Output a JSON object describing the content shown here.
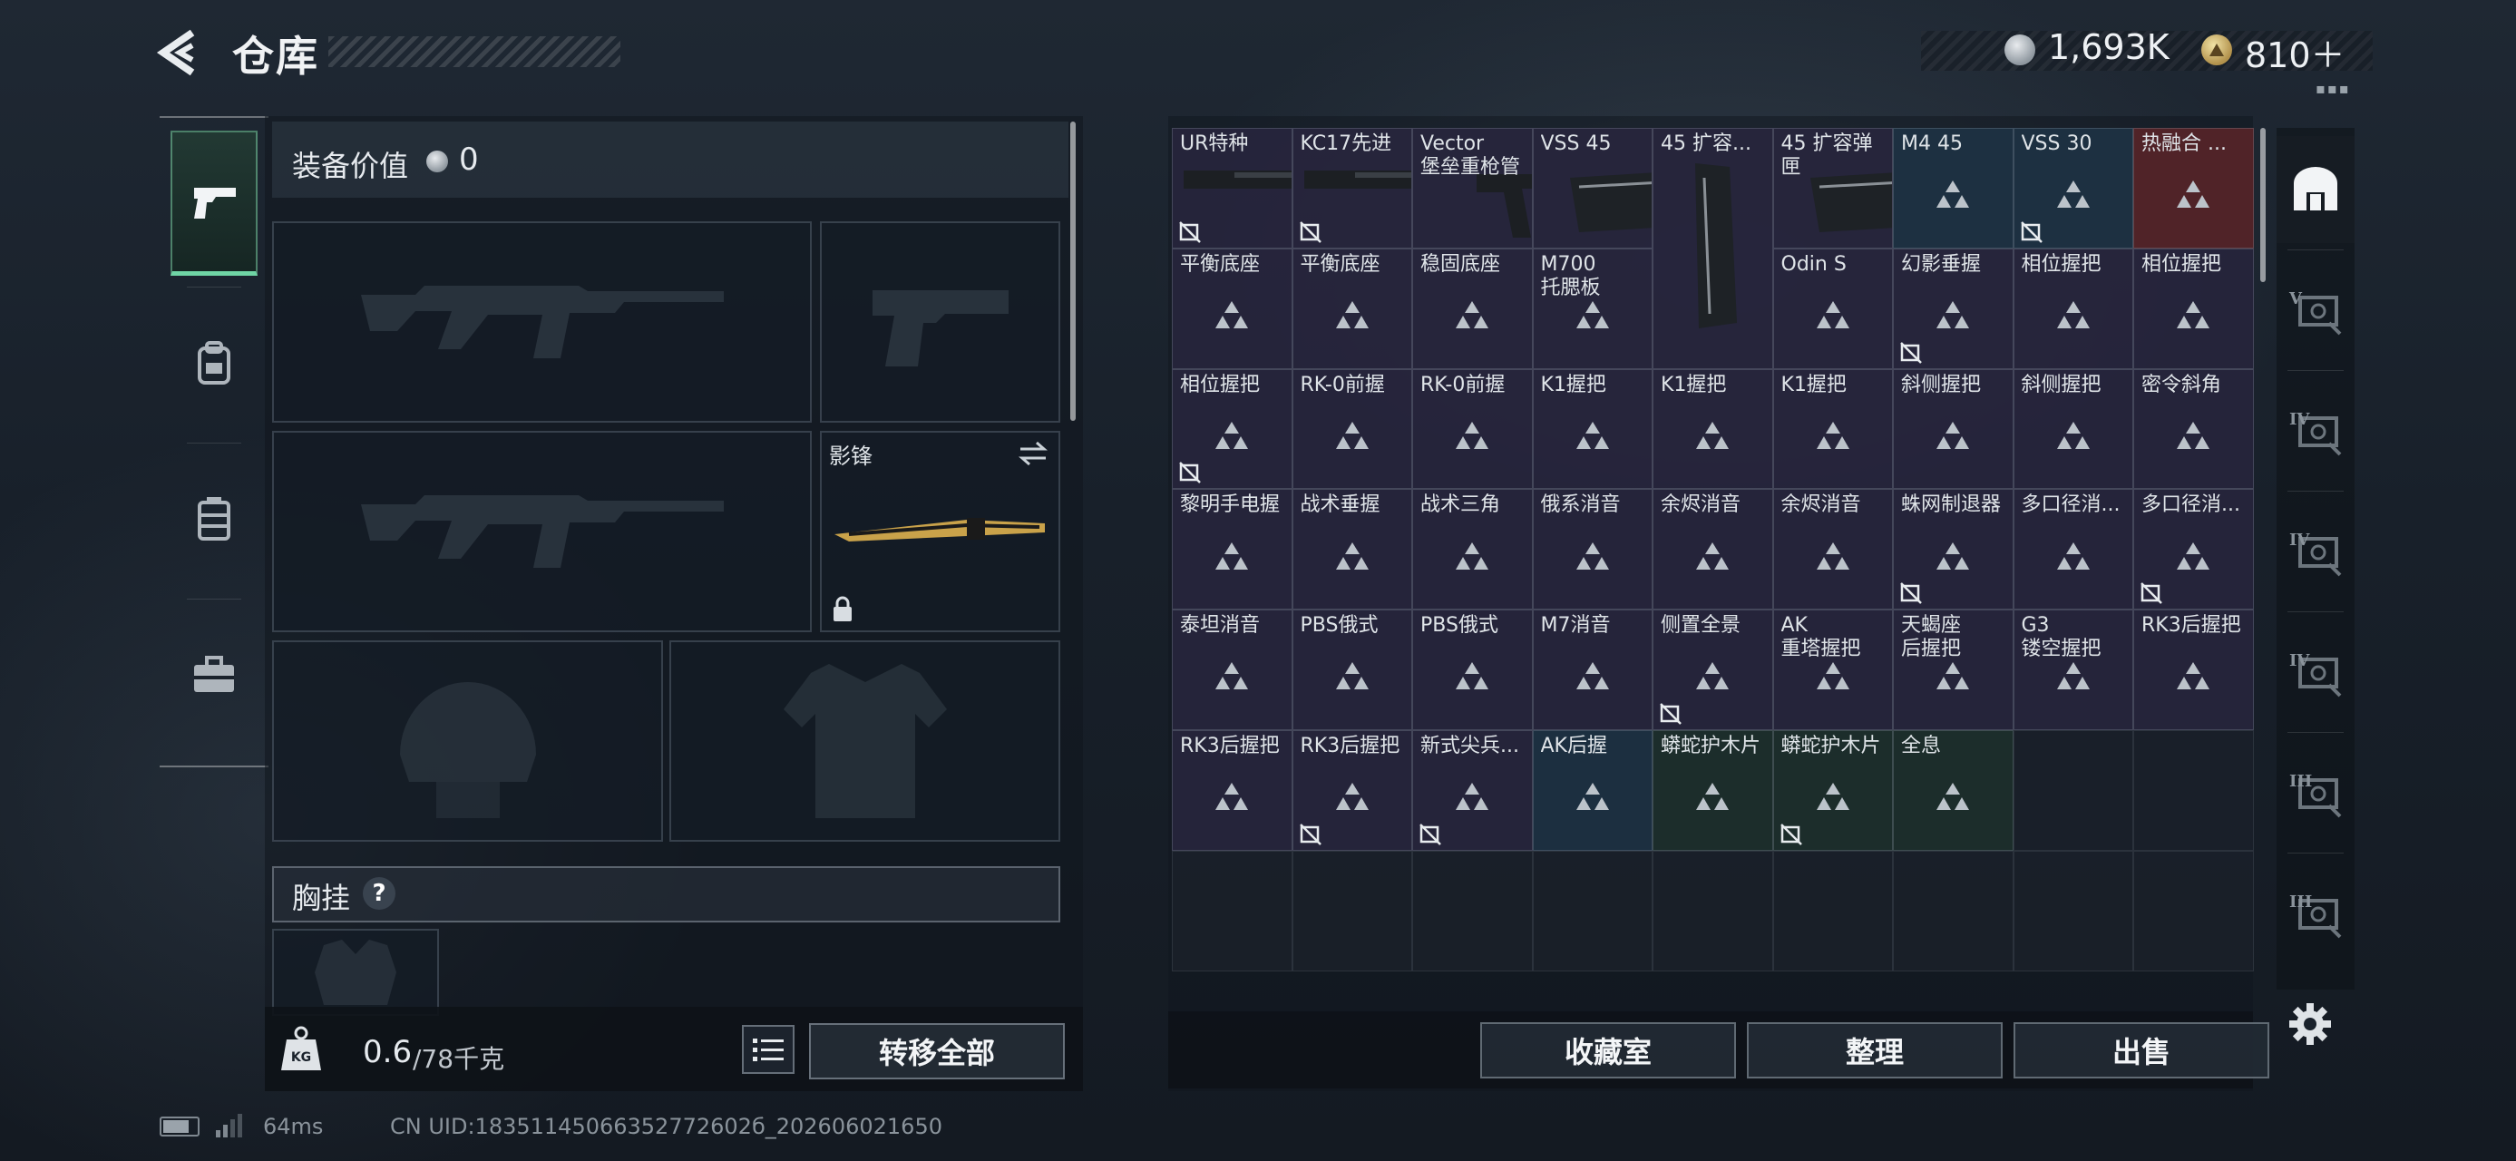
{
  "header": {
    "title": "仓库"
  },
  "currency": {
    "silver": "1,693K",
    "gold": "810＋"
  },
  "loadout": {
    "value_label": "装备价值",
    "value": "0",
    "melee_name": "影锋",
    "chest_label": "胸挂",
    "chest_help": "?",
    "weight_current": "0.6",
    "weight_max": "/78千克",
    "transfer_all": "转移全部"
  },
  "left_rail": {
    "tabs": [
      {
        "name": "weapons-tab",
        "icon": "pistol-icon",
        "active": true
      },
      {
        "name": "gear-tab",
        "icon": "backpack-icon",
        "active": false
      },
      {
        "name": "bag-tab",
        "icon": "vest-icon",
        "active": false
      },
      {
        "name": "toolbox-tab",
        "icon": "toolbox-icon",
        "active": false
      }
    ]
  },
  "storage": {
    "items": [
      {
        "label": "UR特种",
        "rarity": "purple",
        "img": "stock",
        "flag": true
      },
      {
        "label": "KC17先进",
        "rarity": "purple",
        "img": "stock2",
        "flag": true
      },
      {
        "label": "Vector\n堡垒重枪管",
        "rarity": "purple",
        "img": "vector",
        "flag": false
      },
      {
        "label": "VSS 45",
        "rarity": "purple",
        "img": "mag",
        "flag": false
      },
      {
        "label": "45 扩容...",
        "rarity": "purple",
        "img": "magtall",
        "flag": false
      },
      {
        "label": "45 扩容弹匣",
        "rarity": "purple",
        "img": "mag",
        "flag": false
      },
      {
        "label": "M4 45",
        "rarity": "blue",
        "flag": false
      },
      {
        "label": "VSS 30",
        "rarity": "blue",
        "flag": true
      },
      {
        "label": "热融合 ...",
        "rarity": "red",
        "flag": false
      },
      {
        "label": "平衡底座",
        "rarity": "purple",
        "flag": false
      },
      {
        "label": "平衡底座",
        "rarity": "purple",
        "flag": false
      },
      {
        "label": "稳固底座",
        "rarity": "purple",
        "flag": false
      },
      {
        "label": "M700\n托腮板",
        "rarity": "purple",
        "flag": false
      },
      {
        "label": "Odin S",
        "rarity": "purple",
        "flag": false
      },
      {
        "label": "幻影垂握",
        "rarity": "purple",
        "flag": true
      },
      {
        "label": "相位握把",
        "rarity": "purple",
        "flag": false
      },
      {
        "label": "相位握把",
        "rarity": "purple",
        "flag": false
      },
      {
        "label": "相位握把",
        "rarity": "purple",
        "flag": true
      },
      {
        "label": "RK-0前握",
        "rarity": "purple",
        "flag": false
      },
      {
        "label": "RK-0前握",
        "rarity": "purple",
        "flag": false
      },
      {
        "label": "K1握把",
        "rarity": "purple",
        "flag": false
      },
      {
        "label": "K1握把",
        "rarity": "purple",
        "flag": false
      },
      {
        "label": "K1握把",
        "rarity": "purple",
        "flag": false
      },
      {
        "label": "斜侧握把",
        "rarity": "purple",
        "flag": false
      },
      {
        "label": "斜侧握把",
        "rarity": "purple",
        "flag": false
      },
      {
        "label": "密令斜角",
        "rarity": "purple",
        "flag": false
      },
      {
        "label": "黎明手电握",
        "rarity": "purple",
        "flag": false
      },
      {
        "label": "战术垂握",
        "rarity": "purple",
        "flag": false
      },
      {
        "label": "战术三角",
        "rarity": "purple",
        "flag": false
      },
      {
        "label": "俄系消音",
        "rarity": "purple",
        "flag": false
      },
      {
        "label": "余烬消音",
        "rarity": "purple",
        "flag": false
      },
      {
        "label": "余烬消音",
        "rarity": "purple",
        "flag": false
      },
      {
        "label": "蛛网制退器",
        "rarity": "purple",
        "flag": true
      },
      {
        "label": "多口径消...",
        "rarity": "purple",
        "flag": false
      },
      {
        "label": "多口径消...",
        "rarity": "purple",
        "flag": true
      },
      {
        "label": "泰坦消音",
        "rarity": "purple",
        "flag": false
      },
      {
        "label": "PBS俄式",
        "rarity": "purple",
        "flag": false
      },
      {
        "label": "PBS俄式",
        "rarity": "purple",
        "flag": false
      },
      {
        "label": "M7消音",
        "rarity": "purple",
        "flag": false
      },
      {
        "label": "侧置全景",
        "rarity": "purple",
        "flag": true
      },
      {
        "label": "AK\n重塔握把",
        "rarity": "purple",
        "flag": false
      },
      {
        "label": "天蝎座\n后握把",
        "rarity": "purple",
        "flag": false
      },
      {
        "label": "G3\n镂空握把",
        "rarity": "purple",
        "flag": false
      },
      {
        "label": "RK3后握把",
        "rarity": "purple",
        "flag": false
      },
      {
        "label": "RK3后握把",
        "rarity": "purple",
        "flag": false
      },
      {
        "label": "RK3后握把",
        "rarity": "purple",
        "flag": true
      },
      {
        "label": "新式尖兵...",
        "rarity": "purple",
        "flag": true
      },
      {
        "label": "AK后握",
        "rarity": "blue",
        "flag": false
      },
      {
        "label": "蟒蛇护木片",
        "rarity": "green",
        "flag": false
      },
      {
        "label": "蟒蛇护木片",
        "rarity": "green",
        "flag": true
      },
      {
        "label": "全息",
        "rarity": "green",
        "flag": false
      }
    ]
  },
  "actions": {
    "vault": "收藏室",
    "sort": "整理",
    "sell": "出售"
  },
  "tier_rail": {
    "tabs": [
      {
        "name": "tier-home-tab",
        "label": "",
        "active": true
      },
      {
        "name": "tier-v-tab",
        "label": "V",
        "active": false
      },
      {
        "name": "tier-iv-tab-1",
        "label": "IV",
        "active": false
      },
      {
        "name": "tier-iv-tab-2",
        "label": "IV",
        "active": false
      },
      {
        "name": "tier-iv-tab-3",
        "label": "IV",
        "active": false
      },
      {
        "name": "tier-iii-tab-1",
        "label": "III",
        "active": false
      },
      {
        "name": "tier-iii-tab-2",
        "label": "III",
        "active": false
      }
    ]
  },
  "status": {
    "ping": "64ms",
    "uid": "CN UID:18351145066352772602б_202606021650"
  },
  "colors": {
    "accent": "#6fd5a5",
    "rarity_purple": "#28263e",
    "rarity_blue": "#1e3244",
    "rarity_red": "#562428",
    "rarity_green": "#1e302c"
  }
}
